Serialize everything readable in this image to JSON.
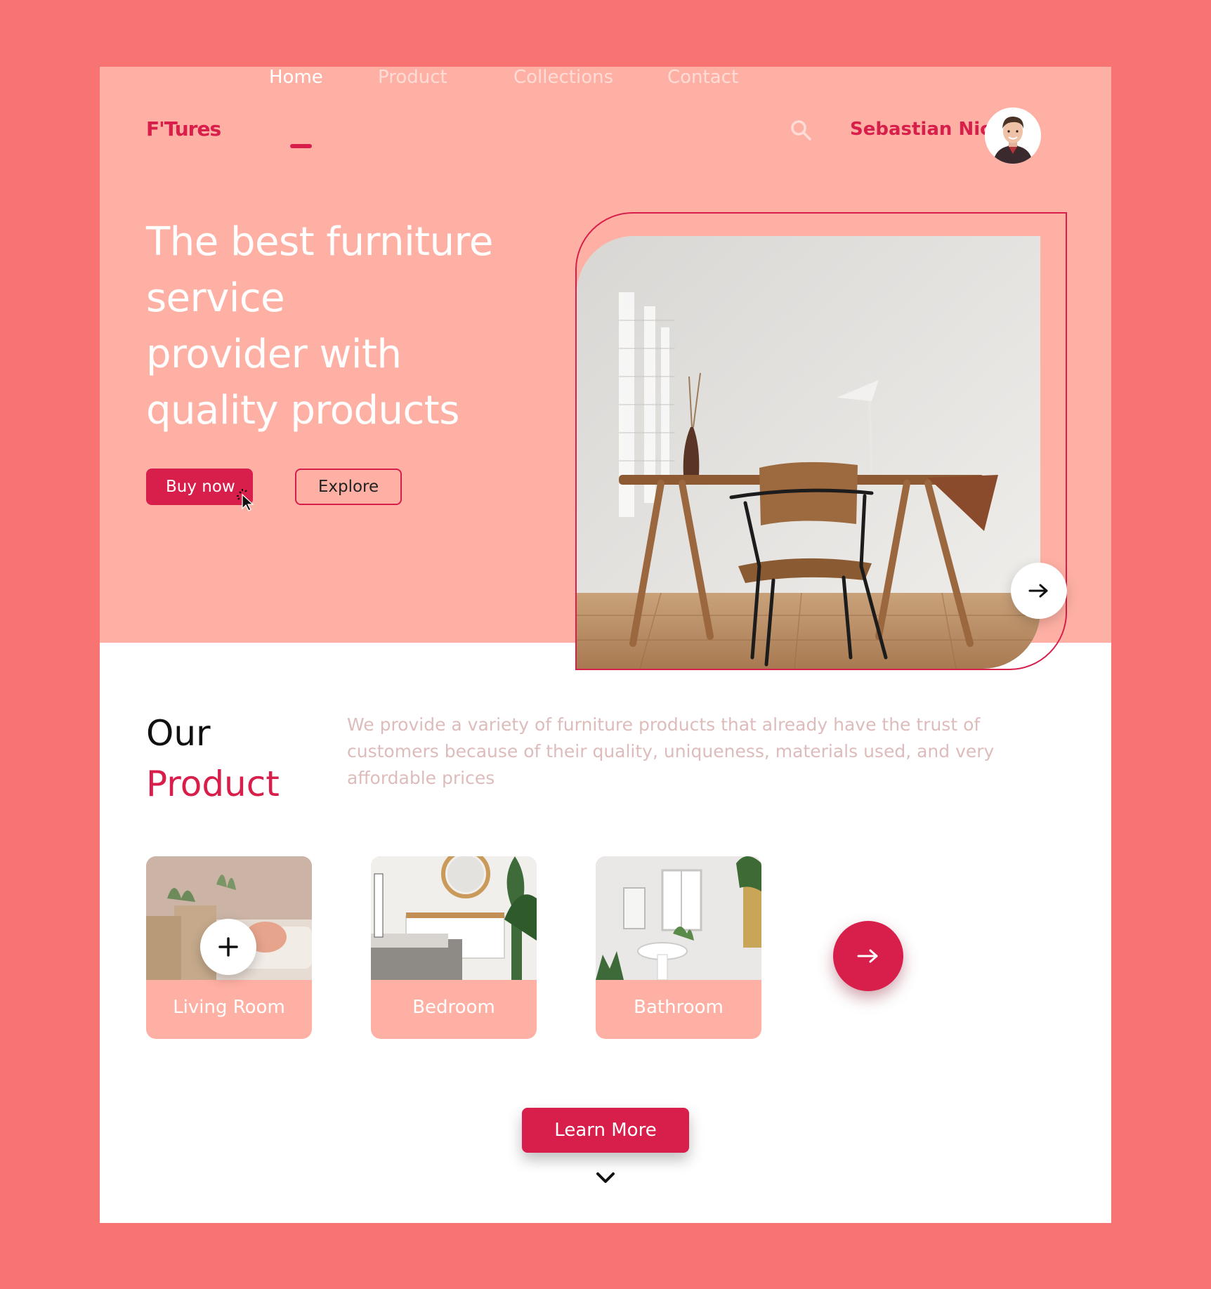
{
  "brand": {
    "logo": "F'Tures",
    "accent": "#d81e4a",
    "hero_bg": "#ffb0a4",
    "page_bg": "#f77472"
  },
  "nav": {
    "items": [
      {
        "label": "Home",
        "active": true
      },
      {
        "label": "Product",
        "active": false
      },
      {
        "label": "Collections",
        "active": false
      },
      {
        "label": "Contact",
        "active": false
      }
    ],
    "search_icon": "search-icon"
  },
  "user": {
    "name": "Sebastian Nic"
  },
  "hero": {
    "title_lines": [
      "The best furniture",
      "service",
      "provider with",
      "quality products"
    ],
    "buy_label": "Buy now",
    "explore_label": "Explore"
  },
  "products": {
    "heading_1": "Our",
    "heading_2": "Product",
    "description": "We provide a variety of furniture products that already have the trust of customers because of their quality, uniqueness, materials used, and very affordable prices",
    "categories": [
      {
        "label": "Living Room"
      },
      {
        "label": "Bedroom"
      },
      {
        "label": "Bathroom"
      }
    ],
    "learn_more_label": "Learn More"
  }
}
